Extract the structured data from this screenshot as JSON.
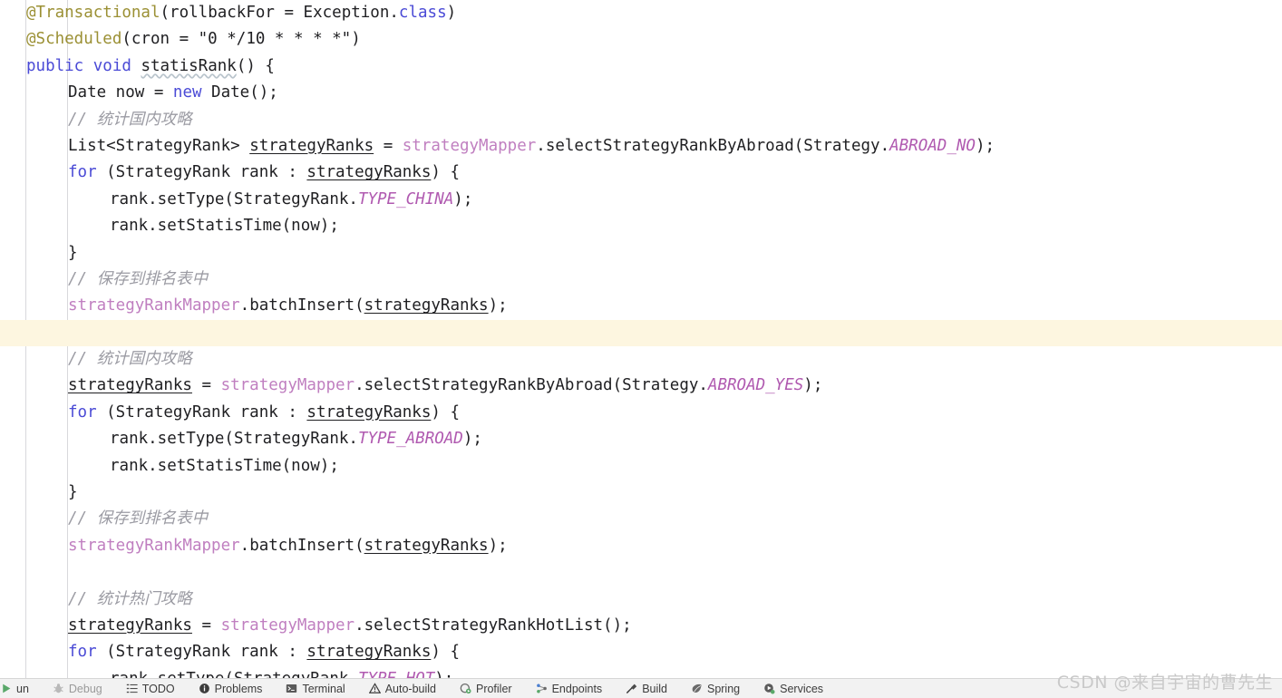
{
  "editor": {
    "language": "java",
    "caret_line_index": 12,
    "indent_guides": [
      28,
      74
    ],
    "colors": {
      "background": "#ffffff",
      "caret_line": "#fdf6e0",
      "annotation": "#9b9034",
      "keyword": "#4a4ad6",
      "comment": "#9b9ba3",
      "field": "#c07fc0",
      "static_field": "#b05ab0",
      "text": "#1f1f22",
      "indent_guide": "#d8d8dc"
    },
    "lines": [
      {
        "indent": 0,
        "tokens": [
          {
            "t": "@Transactional",
            "c": "anno"
          },
          {
            "t": "(rollbackFor = Exception.",
            "c": "plain"
          },
          {
            "t": "class",
            "c": "kw"
          },
          {
            "t": ")",
            "c": "plain"
          }
        ]
      },
      {
        "indent": 0,
        "tokens": [
          {
            "t": "@Scheduled",
            "c": "anno"
          },
          {
            "t": "(cron = \"0 */10 * * * *\")",
            "c": "plain"
          }
        ]
      },
      {
        "indent": 0,
        "tokens": [
          {
            "t": "public",
            "c": "kw"
          },
          {
            "t": " ",
            "c": "plain"
          },
          {
            "t": "void",
            "c": "kw"
          },
          {
            "t": " ",
            "c": "plain"
          },
          {
            "t": "statisRank",
            "c": "method-warn"
          },
          {
            "t": "() {",
            "c": "plain"
          }
        ]
      },
      {
        "indent": 1,
        "tokens": [
          {
            "t": "Date now = ",
            "c": "plain"
          },
          {
            "t": "new",
            "c": "kw"
          },
          {
            "t": " Date();",
            "c": "plain"
          }
        ]
      },
      {
        "indent": 1,
        "tokens": [
          {
            "t": "// 统计国内攻略",
            "c": "comment"
          }
        ]
      },
      {
        "indent": 1,
        "tokens": [
          {
            "t": "List<StrategyRank> ",
            "c": "plain"
          },
          {
            "t": "strategyRanks",
            "c": "local"
          },
          {
            "t": " = ",
            "c": "plain"
          },
          {
            "t": "strategyMapper",
            "c": "field"
          },
          {
            "t": ".selectStrategyRankByAbroad(Strategy.",
            "c": "plain"
          },
          {
            "t": "ABROAD_NO",
            "c": "static"
          },
          {
            "t": ");",
            "c": "plain"
          }
        ]
      },
      {
        "indent": 1,
        "tokens": [
          {
            "t": "for",
            "c": "kw"
          },
          {
            "t": " (StrategyRank rank : ",
            "c": "plain"
          },
          {
            "t": "strategyRanks",
            "c": "local"
          },
          {
            "t": ") {",
            "c": "plain"
          }
        ]
      },
      {
        "indent": 2,
        "tokens": [
          {
            "t": "rank.setType(StrategyRank.",
            "c": "plain"
          },
          {
            "t": "TYPE_CHINA",
            "c": "static"
          },
          {
            "t": ");",
            "c": "plain"
          }
        ]
      },
      {
        "indent": 2,
        "tokens": [
          {
            "t": "rank.setStatisTime(now);",
            "c": "plain"
          }
        ]
      },
      {
        "indent": 1,
        "tokens": [
          {
            "t": "}",
            "c": "plain"
          }
        ]
      },
      {
        "indent": 1,
        "tokens": [
          {
            "t": "// 保存到排名表中",
            "c": "comment"
          }
        ]
      },
      {
        "indent": 1,
        "tokens": [
          {
            "t": "strategyRankMapper",
            "c": "field"
          },
          {
            "t": ".batchInsert(",
            "c": "plain"
          },
          {
            "t": "strategyRanks",
            "c": "local"
          },
          {
            "t": ");",
            "c": "plain"
          }
        ]
      },
      {
        "indent": 1,
        "tokens": []
      },
      {
        "indent": 1,
        "tokens": [
          {
            "t": "// 统计国内攻略",
            "c": "comment"
          }
        ]
      },
      {
        "indent": 1,
        "tokens": [
          {
            "t": "strategyRanks",
            "c": "local"
          },
          {
            "t": " = ",
            "c": "plain"
          },
          {
            "t": "strategyMapper",
            "c": "field"
          },
          {
            "t": ".selectStrategyRankByAbroad(Strategy.",
            "c": "plain"
          },
          {
            "t": "ABROAD_YES",
            "c": "static"
          },
          {
            "t": ");",
            "c": "plain"
          }
        ]
      },
      {
        "indent": 1,
        "tokens": [
          {
            "t": "for",
            "c": "kw"
          },
          {
            "t": " (StrategyRank rank : ",
            "c": "plain"
          },
          {
            "t": "strategyRanks",
            "c": "local"
          },
          {
            "t": ") {",
            "c": "plain"
          }
        ]
      },
      {
        "indent": 2,
        "tokens": [
          {
            "t": "rank.setType(StrategyRank.",
            "c": "plain"
          },
          {
            "t": "TYPE_ABROAD",
            "c": "static"
          },
          {
            "t": ");",
            "c": "plain"
          }
        ]
      },
      {
        "indent": 2,
        "tokens": [
          {
            "t": "rank.setStatisTime(now);",
            "c": "plain"
          }
        ]
      },
      {
        "indent": 1,
        "tokens": [
          {
            "t": "}",
            "c": "plain"
          }
        ]
      },
      {
        "indent": 1,
        "tokens": [
          {
            "t": "// 保存到排名表中",
            "c": "comment"
          }
        ]
      },
      {
        "indent": 1,
        "tokens": [
          {
            "t": "strategyRankMapper",
            "c": "field"
          },
          {
            "t": ".batchInsert(",
            "c": "plain"
          },
          {
            "t": "strategyRanks",
            "c": "local"
          },
          {
            "t": ");",
            "c": "plain"
          }
        ]
      },
      {
        "indent": 1,
        "tokens": []
      },
      {
        "indent": 1,
        "tokens": [
          {
            "t": "// 统计热门攻略",
            "c": "comment"
          }
        ]
      },
      {
        "indent": 1,
        "tokens": [
          {
            "t": "strategyRanks",
            "c": "local"
          },
          {
            "t": " = ",
            "c": "plain"
          },
          {
            "t": "strategyMapper",
            "c": "field"
          },
          {
            "t": ".selectStrategyRankHotList();",
            "c": "plain"
          }
        ]
      },
      {
        "indent": 1,
        "tokens": [
          {
            "t": "for",
            "c": "kw"
          },
          {
            "t": " (StrategyRank rank : ",
            "c": "plain"
          },
          {
            "t": "strategyRanks",
            "c": "local"
          },
          {
            "t": ") {",
            "c": "plain"
          }
        ]
      },
      {
        "indent": 2,
        "tokens": [
          {
            "t": "rank.setType(StrategyRank.",
            "c": "plain"
          },
          {
            "t": "TYPE_HOT",
            "c": "static"
          },
          {
            "t": ");",
            "c": "plain"
          }
        ]
      }
    ]
  },
  "statusbar": {
    "items": [
      {
        "label": "un",
        "icon": "run-icon",
        "dim": false,
        "truncated": true
      },
      {
        "label": "Debug",
        "icon": "bug-icon",
        "dim": true
      },
      {
        "label": "TODO",
        "icon": "todo-list-icon",
        "dim": false
      },
      {
        "label": "Problems",
        "icon": "problems-info-icon",
        "dim": false
      },
      {
        "label": "Terminal",
        "icon": "terminal-icon",
        "dim": false
      },
      {
        "label": "Auto-build",
        "icon": "warning-triangle-icon",
        "dim": false
      },
      {
        "label": "Profiler",
        "icon": "profiler-icon",
        "dim": false
      },
      {
        "label": "Endpoints",
        "icon": "endpoints-icon",
        "dim": false
      },
      {
        "label": "Build",
        "icon": "hammer-icon",
        "dim": false
      },
      {
        "label": "Spring",
        "icon": "spring-leaf-icon",
        "dim": false
      },
      {
        "label": "Services",
        "icon": "services-icon",
        "dim": false
      }
    ]
  },
  "watermark": {
    "text": "CSDN @来自宇宙的曹先生"
  }
}
